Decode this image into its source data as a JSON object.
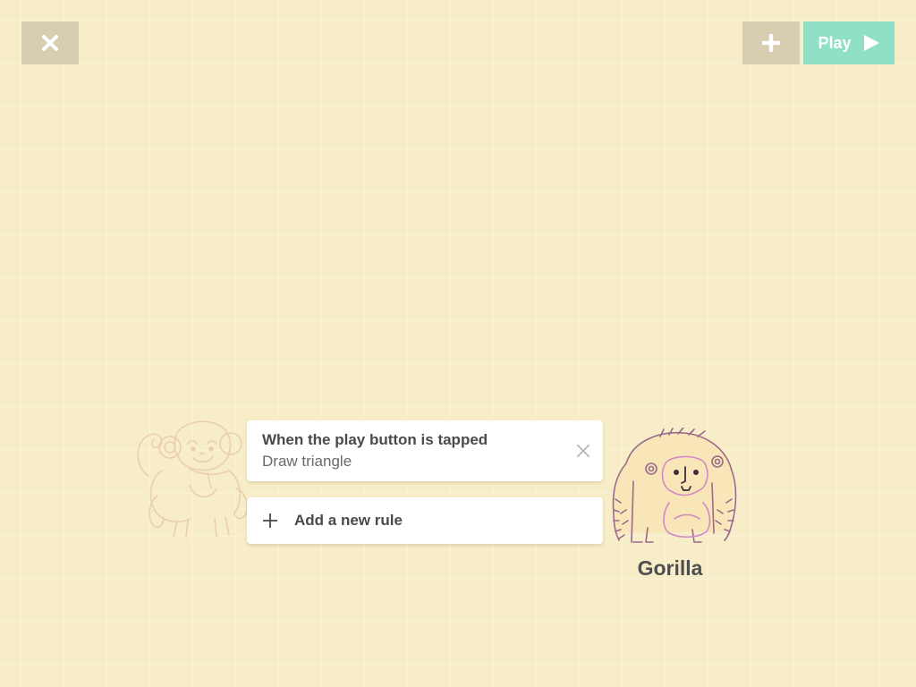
{
  "toolbar": {
    "close_icon": "close-icon",
    "add_icon": "plus-icon",
    "play_label": "Play",
    "play_icon": "play-triangle-icon",
    "play_color": "#8fe0c6",
    "secondary_color": "#d7cdb1"
  },
  "rules": [
    {
      "trigger": "When the play button is tapped",
      "action": "Draw triangle",
      "remove_icon": "close-icon"
    }
  ],
  "add_rule": {
    "label": "Add a new rule",
    "icon": "plus-icon"
  },
  "characters": {
    "previous": {
      "icon": "monkey-icon"
    },
    "current": {
      "name": "Gorilla",
      "icon": "gorilla-icon"
    }
  },
  "background_color": "#f7edc9"
}
